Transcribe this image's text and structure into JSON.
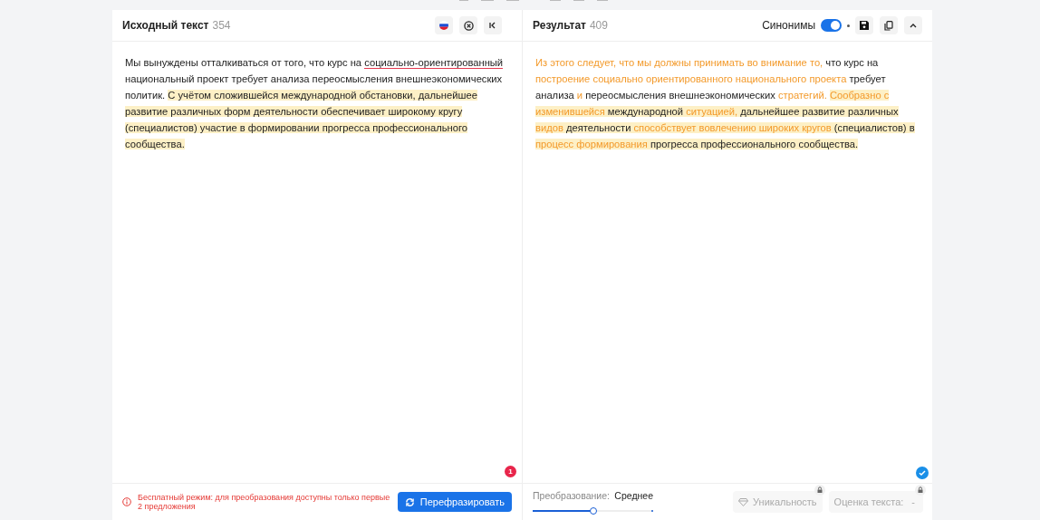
{
  "source": {
    "title": "Исходный текст",
    "count": "354",
    "segments": [
      {
        "text": "Мы вынуждены отталкиваться от того, что курс на ",
        "underlined": false,
        "highlight": false
      },
      {
        "text": "социально-ориентированный",
        "underlined": true,
        "highlight": false
      },
      {
        "text": " национальный проект требует анализа переосмысления внешнеэкономических политик. ",
        "underlined": false,
        "highlight": false
      },
      {
        "text": "С учётом сложившейся международной обстановки, дальнейшее развитие различных форм деятельности обеспечивает широкому кругу (специалистов) участие в формировании прогресса профессионального сообщества.",
        "underlined": false,
        "highlight": true
      }
    ],
    "error_count": "1",
    "warning": "Бесплатный режим: для преобразования доступны только первые 2 предложения",
    "button": "Перефразировать"
  },
  "result": {
    "title": "Результат",
    "count": "409",
    "synonyms_label": "Синонимы",
    "synonyms_on": true,
    "segments": [
      {
        "text": "Из этого следует, что мы должны принимать во внимание то,",
        "changed": true,
        "highlight": false
      },
      {
        "text": " что курс на ",
        "changed": false,
        "highlight": false
      },
      {
        "text": "построение социально ориентированного национального проекта",
        "changed": true,
        "highlight": false
      },
      {
        "text": " требует анализа ",
        "changed": false,
        "highlight": false
      },
      {
        "text": "и",
        "changed": true,
        "highlight": false
      },
      {
        "text": " переосмысления внешнеэкономических ",
        "changed": false,
        "highlight": false
      },
      {
        "text": "стратегий. ",
        "changed": true,
        "highlight": false
      },
      {
        "text": "Сообразно с изменившейся",
        "changed": true,
        "highlight": true
      },
      {
        "text": " международной ",
        "changed": false,
        "highlight": true
      },
      {
        "text": "ситуацией,",
        "changed": true,
        "highlight": true
      },
      {
        "text": " дальнейшее развитие различных ",
        "changed": false,
        "highlight": true
      },
      {
        "text": "видов",
        "changed": true,
        "highlight": true
      },
      {
        "text": " деятельности ",
        "changed": false,
        "highlight": true
      },
      {
        "text": "способствует вовлечению широких кругов",
        "changed": true,
        "highlight": true
      },
      {
        "text": " (специалистов) в ",
        "changed": false,
        "highlight": true
      },
      {
        "text": "процесс формирования",
        "changed": true,
        "highlight": true
      },
      {
        "text": " прогресса профессионального сообщества.",
        "changed": false,
        "highlight": true
      }
    ],
    "transform_label": "Преобразование:",
    "transform_value": "Среднее",
    "level": 0.5,
    "uniqueness": "Уникальность",
    "score_label": "Оценка текста:",
    "score_value": "-"
  }
}
